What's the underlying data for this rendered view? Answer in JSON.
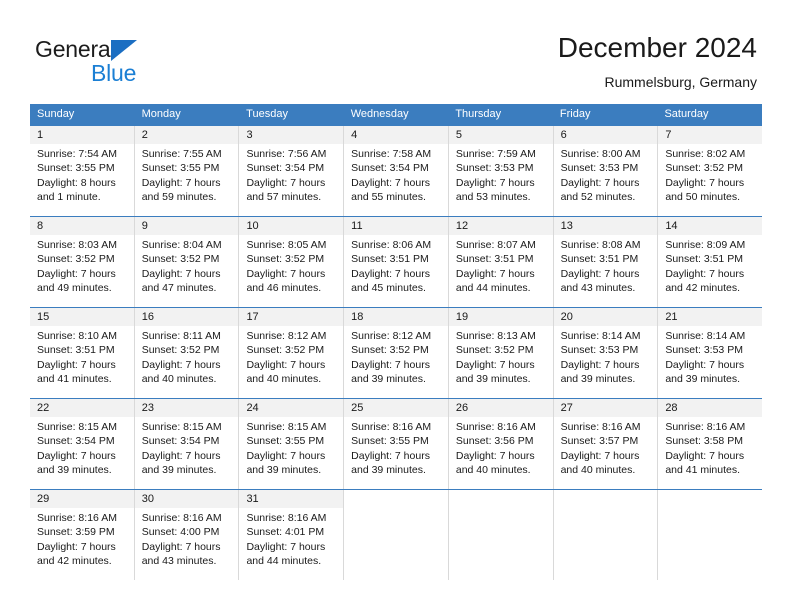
{
  "brand": {
    "name_part1": "General",
    "name_part2": "Blue",
    "accent_color": "#1b7fd4",
    "triangle_color": "#1b6ec2"
  },
  "header": {
    "month_title": "December 2024",
    "location": "Rummelsburg, Germany"
  },
  "calendar": {
    "header_bg": "#3b7dbf",
    "day_number_bg": "#f2f2f2",
    "weekdays": [
      "Sunday",
      "Monday",
      "Tuesday",
      "Wednesday",
      "Thursday",
      "Friday",
      "Saturday"
    ],
    "weeks": [
      [
        {
          "day": "1",
          "sunrise": "Sunrise: 7:54 AM",
          "sunset": "Sunset: 3:55 PM",
          "daylight_line1": "Daylight: 8 hours",
          "daylight_line2": "and 1 minute."
        },
        {
          "day": "2",
          "sunrise": "Sunrise: 7:55 AM",
          "sunset": "Sunset: 3:55 PM",
          "daylight_line1": "Daylight: 7 hours",
          "daylight_line2": "and 59 minutes."
        },
        {
          "day": "3",
          "sunrise": "Sunrise: 7:56 AM",
          "sunset": "Sunset: 3:54 PM",
          "daylight_line1": "Daylight: 7 hours",
          "daylight_line2": "and 57 minutes."
        },
        {
          "day": "4",
          "sunrise": "Sunrise: 7:58 AM",
          "sunset": "Sunset: 3:54 PM",
          "daylight_line1": "Daylight: 7 hours",
          "daylight_line2": "and 55 minutes."
        },
        {
          "day": "5",
          "sunrise": "Sunrise: 7:59 AM",
          "sunset": "Sunset: 3:53 PM",
          "daylight_line1": "Daylight: 7 hours",
          "daylight_line2": "and 53 minutes."
        },
        {
          "day": "6",
          "sunrise": "Sunrise: 8:00 AM",
          "sunset": "Sunset: 3:53 PM",
          "daylight_line1": "Daylight: 7 hours",
          "daylight_line2": "and 52 minutes."
        },
        {
          "day": "7",
          "sunrise": "Sunrise: 8:02 AM",
          "sunset": "Sunset: 3:52 PM",
          "daylight_line1": "Daylight: 7 hours",
          "daylight_line2": "and 50 minutes."
        }
      ],
      [
        {
          "day": "8",
          "sunrise": "Sunrise: 8:03 AM",
          "sunset": "Sunset: 3:52 PM",
          "daylight_line1": "Daylight: 7 hours",
          "daylight_line2": "and 49 minutes."
        },
        {
          "day": "9",
          "sunrise": "Sunrise: 8:04 AM",
          "sunset": "Sunset: 3:52 PM",
          "daylight_line1": "Daylight: 7 hours",
          "daylight_line2": "and 47 minutes."
        },
        {
          "day": "10",
          "sunrise": "Sunrise: 8:05 AM",
          "sunset": "Sunset: 3:52 PM",
          "daylight_line1": "Daylight: 7 hours",
          "daylight_line2": "and 46 minutes."
        },
        {
          "day": "11",
          "sunrise": "Sunrise: 8:06 AM",
          "sunset": "Sunset: 3:51 PM",
          "daylight_line1": "Daylight: 7 hours",
          "daylight_line2": "and 45 minutes."
        },
        {
          "day": "12",
          "sunrise": "Sunrise: 8:07 AM",
          "sunset": "Sunset: 3:51 PM",
          "daylight_line1": "Daylight: 7 hours",
          "daylight_line2": "and 44 minutes."
        },
        {
          "day": "13",
          "sunrise": "Sunrise: 8:08 AM",
          "sunset": "Sunset: 3:51 PM",
          "daylight_line1": "Daylight: 7 hours",
          "daylight_line2": "and 43 minutes."
        },
        {
          "day": "14",
          "sunrise": "Sunrise: 8:09 AM",
          "sunset": "Sunset: 3:51 PM",
          "daylight_line1": "Daylight: 7 hours",
          "daylight_line2": "and 42 minutes."
        }
      ],
      [
        {
          "day": "15",
          "sunrise": "Sunrise: 8:10 AM",
          "sunset": "Sunset: 3:51 PM",
          "daylight_line1": "Daylight: 7 hours",
          "daylight_line2": "and 41 minutes."
        },
        {
          "day": "16",
          "sunrise": "Sunrise: 8:11 AM",
          "sunset": "Sunset: 3:52 PM",
          "daylight_line1": "Daylight: 7 hours",
          "daylight_line2": "and 40 minutes."
        },
        {
          "day": "17",
          "sunrise": "Sunrise: 8:12 AM",
          "sunset": "Sunset: 3:52 PM",
          "daylight_line1": "Daylight: 7 hours",
          "daylight_line2": "and 40 minutes."
        },
        {
          "day": "18",
          "sunrise": "Sunrise: 8:12 AM",
          "sunset": "Sunset: 3:52 PM",
          "daylight_line1": "Daylight: 7 hours",
          "daylight_line2": "and 39 minutes."
        },
        {
          "day": "19",
          "sunrise": "Sunrise: 8:13 AM",
          "sunset": "Sunset: 3:52 PM",
          "daylight_line1": "Daylight: 7 hours",
          "daylight_line2": "and 39 minutes."
        },
        {
          "day": "20",
          "sunrise": "Sunrise: 8:14 AM",
          "sunset": "Sunset: 3:53 PM",
          "daylight_line1": "Daylight: 7 hours",
          "daylight_line2": "and 39 minutes."
        },
        {
          "day": "21",
          "sunrise": "Sunrise: 8:14 AM",
          "sunset": "Sunset: 3:53 PM",
          "daylight_line1": "Daylight: 7 hours",
          "daylight_line2": "and 39 minutes."
        }
      ],
      [
        {
          "day": "22",
          "sunrise": "Sunrise: 8:15 AM",
          "sunset": "Sunset: 3:54 PM",
          "daylight_line1": "Daylight: 7 hours",
          "daylight_line2": "and 39 minutes."
        },
        {
          "day": "23",
          "sunrise": "Sunrise: 8:15 AM",
          "sunset": "Sunset: 3:54 PM",
          "daylight_line1": "Daylight: 7 hours",
          "daylight_line2": "and 39 minutes."
        },
        {
          "day": "24",
          "sunrise": "Sunrise: 8:15 AM",
          "sunset": "Sunset: 3:55 PM",
          "daylight_line1": "Daylight: 7 hours",
          "daylight_line2": "and 39 minutes."
        },
        {
          "day": "25",
          "sunrise": "Sunrise: 8:16 AM",
          "sunset": "Sunset: 3:55 PM",
          "daylight_line1": "Daylight: 7 hours",
          "daylight_line2": "and 39 minutes."
        },
        {
          "day": "26",
          "sunrise": "Sunrise: 8:16 AM",
          "sunset": "Sunset: 3:56 PM",
          "daylight_line1": "Daylight: 7 hours",
          "daylight_line2": "and 40 minutes."
        },
        {
          "day": "27",
          "sunrise": "Sunrise: 8:16 AM",
          "sunset": "Sunset: 3:57 PM",
          "daylight_line1": "Daylight: 7 hours",
          "daylight_line2": "and 40 minutes."
        },
        {
          "day": "28",
          "sunrise": "Sunrise: 8:16 AM",
          "sunset": "Sunset: 3:58 PM",
          "daylight_line1": "Daylight: 7 hours",
          "daylight_line2": "and 41 minutes."
        }
      ],
      [
        {
          "day": "29",
          "sunrise": "Sunrise: 8:16 AM",
          "sunset": "Sunset: 3:59 PM",
          "daylight_line1": "Daylight: 7 hours",
          "daylight_line2": "and 42 minutes."
        },
        {
          "day": "30",
          "sunrise": "Sunrise: 8:16 AM",
          "sunset": "Sunset: 4:00 PM",
          "daylight_line1": "Daylight: 7 hours",
          "daylight_line2": "and 43 minutes."
        },
        {
          "day": "31",
          "sunrise": "Sunrise: 8:16 AM",
          "sunset": "Sunset: 4:01 PM",
          "daylight_line1": "Daylight: 7 hours",
          "daylight_line2": "and 44 minutes."
        },
        {
          "day": "",
          "sunrise": "",
          "sunset": "",
          "daylight_line1": "",
          "daylight_line2": ""
        },
        {
          "day": "",
          "sunrise": "",
          "sunset": "",
          "daylight_line1": "",
          "daylight_line2": ""
        },
        {
          "day": "",
          "sunrise": "",
          "sunset": "",
          "daylight_line1": "",
          "daylight_line2": ""
        },
        {
          "day": "",
          "sunrise": "",
          "sunset": "",
          "daylight_line1": "",
          "daylight_line2": ""
        }
      ]
    ]
  }
}
